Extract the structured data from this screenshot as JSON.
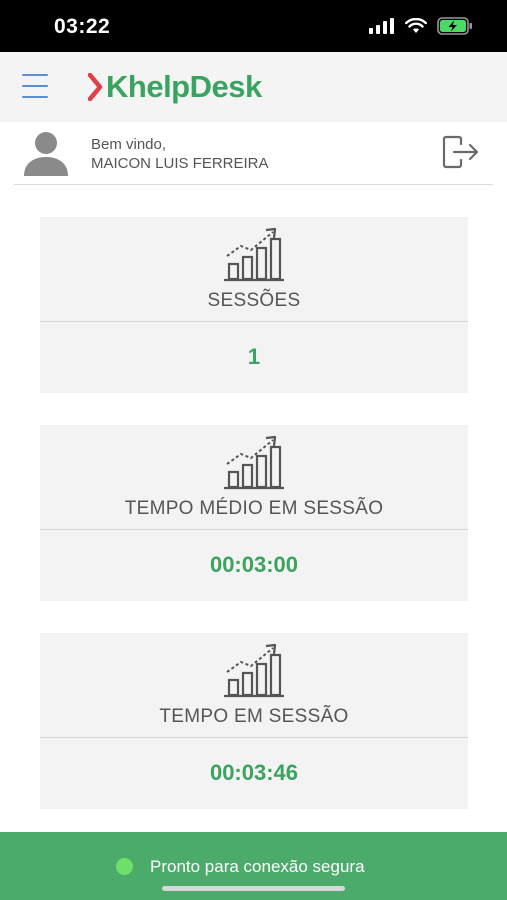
{
  "status_bar": {
    "time": "03:22",
    "icons": [
      "cellular-signal-icon",
      "wifi-icon",
      "battery-charging-icon"
    ]
  },
  "header": {
    "logo_text": "helpDesk",
    "logo_mark": "K",
    "menu_icon": "hamburger-menu-icon",
    "brand_color": "#3aa35f",
    "accent_color": "#e0404a"
  },
  "user": {
    "greeting": "Bem vindo,",
    "name": "MAICON LUIS FERREIRA",
    "avatar_icon": "user-avatar-icon",
    "logout_icon": "logout-icon"
  },
  "cards": [
    {
      "title": "SESSÕES",
      "value": "1",
      "icon": "bar-chart-growth-icon"
    },
    {
      "title": "TEMPO MÉDIO EM SESSÃO",
      "value": "00:03:00",
      "icon": "bar-chart-growth-icon"
    },
    {
      "title": "TEMPO EM SESSÃO",
      "value": "00:03:46",
      "icon": "bar-chart-growth-icon"
    }
  ],
  "footer": {
    "status_text": "Pronto para conexão segura",
    "status_color": "#6ee06a",
    "background_color": "#4caa6b"
  }
}
